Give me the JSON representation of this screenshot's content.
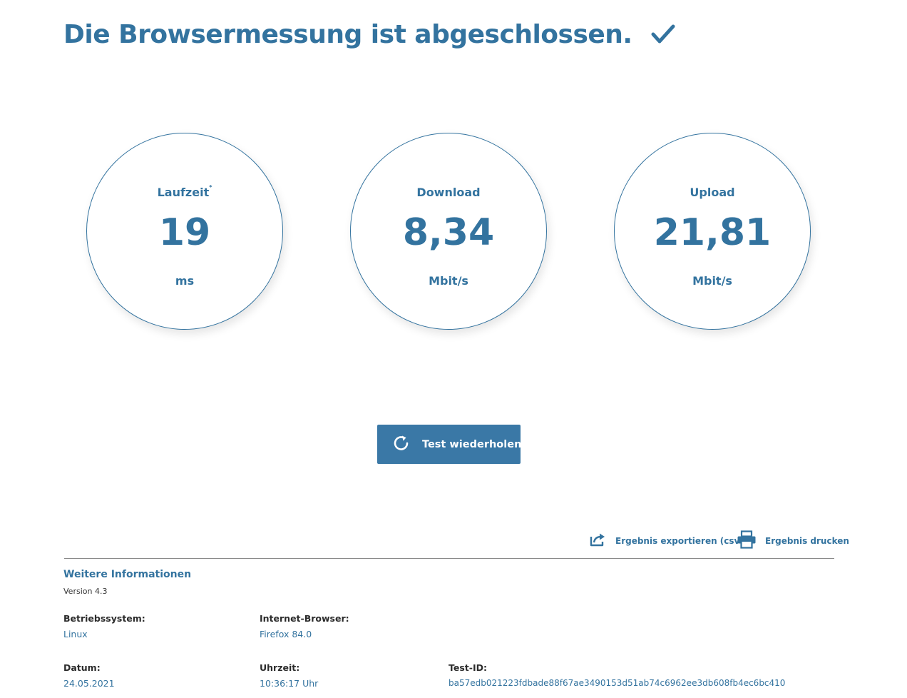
{
  "header": {
    "title": "Die Browsermessung ist abgeschlossen."
  },
  "gauges": {
    "latency": {
      "label": "Laufzeit",
      "footnote_mark": "*",
      "value": "19",
      "unit": "ms"
    },
    "download": {
      "label": "Download",
      "value": "8,34",
      "unit": "Mbit/s"
    },
    "upload": {
      "label": "Upload",
      "value": "21,81",
      "unit": "Mbit/s"
    }
  },
  "actions": {
    "repeat_label": "Test wiederholen",
    "export_label": "Ergebnis exportieren (csv)",
    "print_label": "Ergebnis drucken"
  },
  "info": {
    "title": "Weitere Informationen",
    "version": "Version 4.3",
    "os_label": "Betriebssystem:",
    "os_value": "Linux",
    "browser_label": "Internet-Browser:",
    "browser_value": "Firefox 84.0",
    "date_label": "Datum:",
    "date_value": "24.05.2021",
    "time_label": "Uhrzeit:",
    "time_value": "10:36:17 Uhr",
    "testid_label": "Test-ID:",
    "testid_value": "ba57edb021223fdbade88f67ae3490153d51ab74c6962ee3db608fb4ec6bc410"
  },
  "icons": {
    "check": "check-icon",
    "repeat": "refresh-icon",
    "export": "export-icon",
    "print": "printer-icon"
  },
  "colors": {
    "primary": "#33739f",
    "button": "#3a78a6"
  }
}
